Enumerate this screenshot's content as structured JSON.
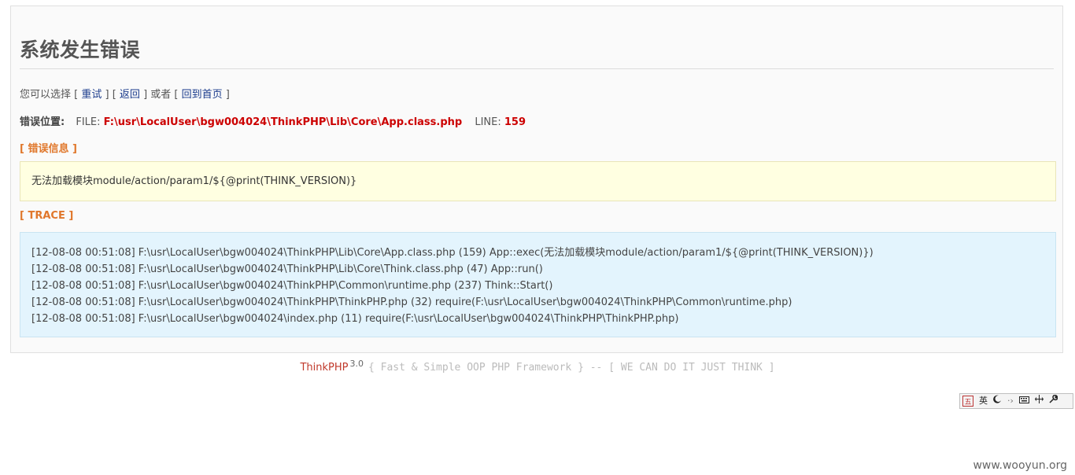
{
  "page": {
    "title": "系统发生错误"
  },
  "choose": {
    "prefix": "您可以选择",
    "retry": "重试",
    "back": "返回",
    "or": "或者",
    "home": "回到首页"
  },
  "position": {
    "label": "错误位置:",
    "file_label": "FILE:",
    "file": "F:\\usr\\LocalUser\\bgw004024\\ThinkPHP\\Lib\\Core\\App.class.php",
    "line_label": "LINE:",
    "line": "159"
  },
  "error": {
    "heading": "[ 错误信息 ]",
    "message": "无法加载模块module/action/param1/${@print(THINK_VERSION)}"
  },
  "trace": {
    "heading": "[ TRACE ]",
    "lines": [
      "[12-08-08 00:51:08] F:\\usr\\LocalUser\\bgw004024\\ThinkPHP\\Lib\\Core\\App.class.php (159) App::exec(无法加载模块module/action/param1/${@print(THINK_VERSION)})",
      "[12-08-08 00:51:08] F:\\usr\\LocalUser\\bgw004024\\ThinkPHP\\Lib\\Core\\Think.class.php (47) App::run()",
      "[12-08-08 00:51:08] F:\\usr\\LocalUser\\bgw004024\\ThinkPHP\\Common\\runtime.php (237) Think::Start()",
      "[12-08-08 00:51:08] F:\\usr\\LocalUser\\bgw004024\\ThinkPHP\\ThinkPHP.php (32) require(F:\\usr\\LocalUser\\bgw004024\\ThinkPHP\\Common\\runtime.php)",
      "[12-08-08 00:51:08] F:\\usr\\LocalUser\\bgw004024\\index.php (11) require(F:\\usr\\LocalUser\\bgw004024\\ThinkPHP\\ThinkPHP.php)"
    ]
  },
  "footer": {
    "brand": "ThinkPHP",
    "version": "3.0",
    "slogan": "{ Fast & Simple OOP PHP Framework } -- [ WE CAN DO IT JUST THINK ]"
  },
  "ime": {
    "logo": "五",
    "lang": "英",
    "icons": [
      "moon-icon",
      "punctuation-icon",
      "keyboard-icon",
      "width-icon",
      "wrench-icon"
    ]
  },
  "watermark": "www.wooyun.org",
  "colors": {
    "accent_orange": "#e0772b",
    "error_red": "#cc0000",
    "error_bg": "#ffffe1",
    "trace_bg": "#e3f4fd"
  }
}
